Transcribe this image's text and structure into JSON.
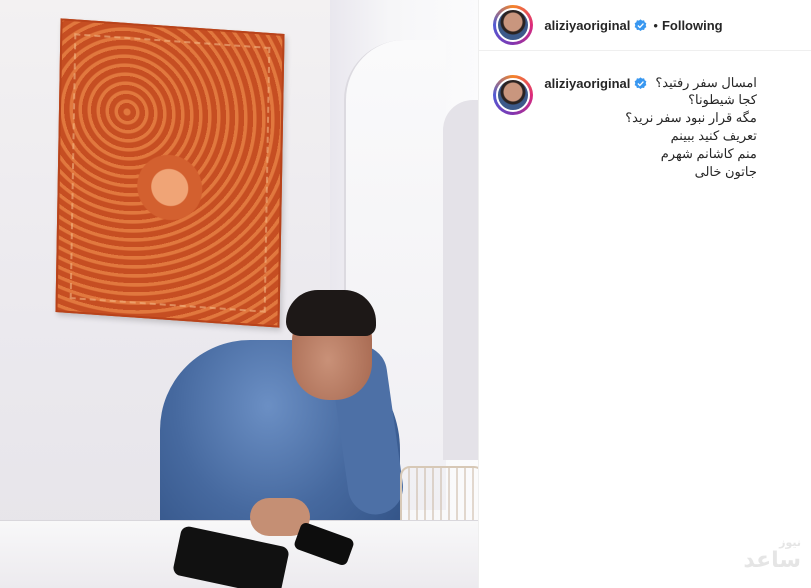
{
  "post": {
    "username": "aliziyaoriginal",
    "follow_state": "Following",
    "separator": "•",
    "caption_lines": [
      "امسال سفر رفتید؟",
      "کجا شیطونا؟",
      "مگه قرار نبود سفر نرید؟",
      "تعریف کنید ببینم",
      "منم کاشانم شهرم",
      "جاتون خالی"
    ]
  },
  "watermark": {
    "small": "نیوز",
    "large": "ساعد"
  },
  "icons": {
    "verified": "verified-badge-icon"
  },
  "colors": {
    "verified_blue": "#3897f0",
    "text": "#262626"
  }
}
